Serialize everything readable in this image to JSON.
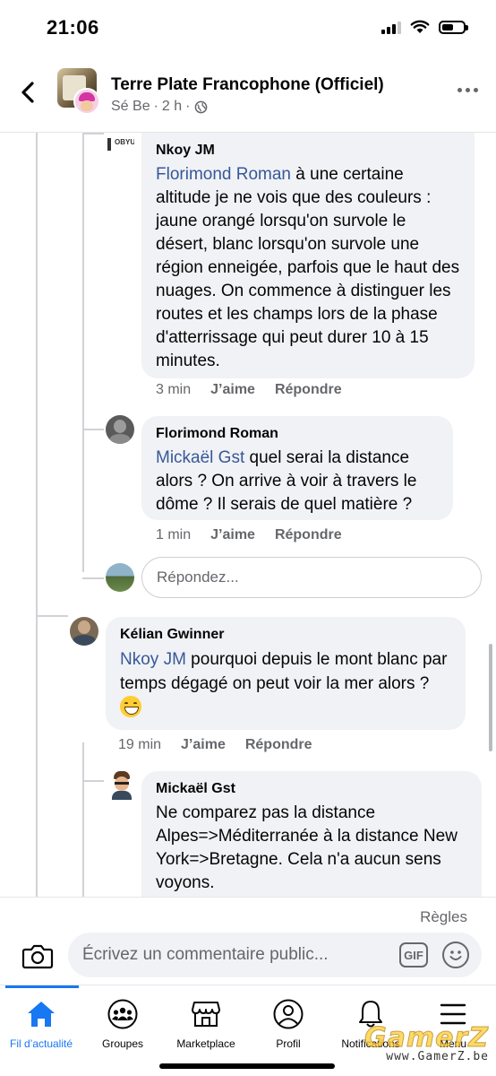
{
  "status": {
    "time": "21:06"
  },
  "header": {
    "title": "Terre Plate Francophone (Officiel)",
    "author": "Sé Be",
    "dot": "·",
    "age": "2 h",
    "privacy_icon": "globe-icon"
  },
  "comments": [
    {
      "author": "Nkoy JM",
      "mention": "Florimond Roman",
      "text": " à une certaine altitude je ne vois que des couleurs : jaune orangé lorsqu'on survole le désert, blanc lorsqu'on survole une région enneigée, parfois que le haut des nuages. On commence à distinguer les routes et les champs lors de la phase d'atterrissage qui peut durer 10 à 15 minutes.",
      "time": "3 min",
      "like": "J’aime",
      "reply": "Répondre",
      "avatar_text": "OBYU"
    },
    {
      "author": "Florimond Roman",
      "mention": "Mickaël Gst",
      "text": " quel serai la distance alors ? On arrive à voir à travers le dôme ? Il serais de quel matière ?",
      "time": "1 min",
      "like": "J’aime",
      "reply": "Répondre"
    },
    {
      "author": "Kélian Gwinner",
      "mention": "Nkoy JM",
      "text": " pourquoi depuis le mont blanc par temps dégagé on peut voir la mer alors ? ",
      "emoji": "grinning-face-emoji",
      "time": "19 min",
      "like": "J’aime",
      "reply": "Répondre"
    },
    {
      "author": "Mickaël Gst",
      "text": "Ne comparez pas la distance Alpes=>Méditerranée à la distance New York=>Bretagne. Cela n'a aucun sens voyons."
    }
  ],
  "reply_input": {
    "placeholder": "Répondez..."
  },
  "composer": {
    "rules": "Règles",
    "placeholder": "Écrivez un commentaire public...",
    "gif": "GIF"
  },
  "tabs": [
    {
      "label": "Fil d’actualité",
      "icon": "home-icon",
      "active": true
    },
    {
      "label": "Groupes",
      "icon": "groups-icon",
      "active": false
    },
    {
      "label": "Marketplace",
      "icon": "marketplace-icon",
      "active": false
    },
    {
      "label": "Profil",
      "icon": "profile-icon",
      "active": false
    },
    {
      "label": "Notifications",
      "icon": "bell-icon",
      "active": false
    },
    {
      "label": "Menu",
      "icon": "menu-icon",
      "active": false
    }
  ],
  "watermark": {
    "logo": "GamerZ",
    "url": "www.GamerZ.be"
  },
  "colors": {
    "accent": "#1877f2",
    "mention": "#385898",
    "bubble": "#f0f2f5",
    "secondary_text": "#65676b"
  }
}
